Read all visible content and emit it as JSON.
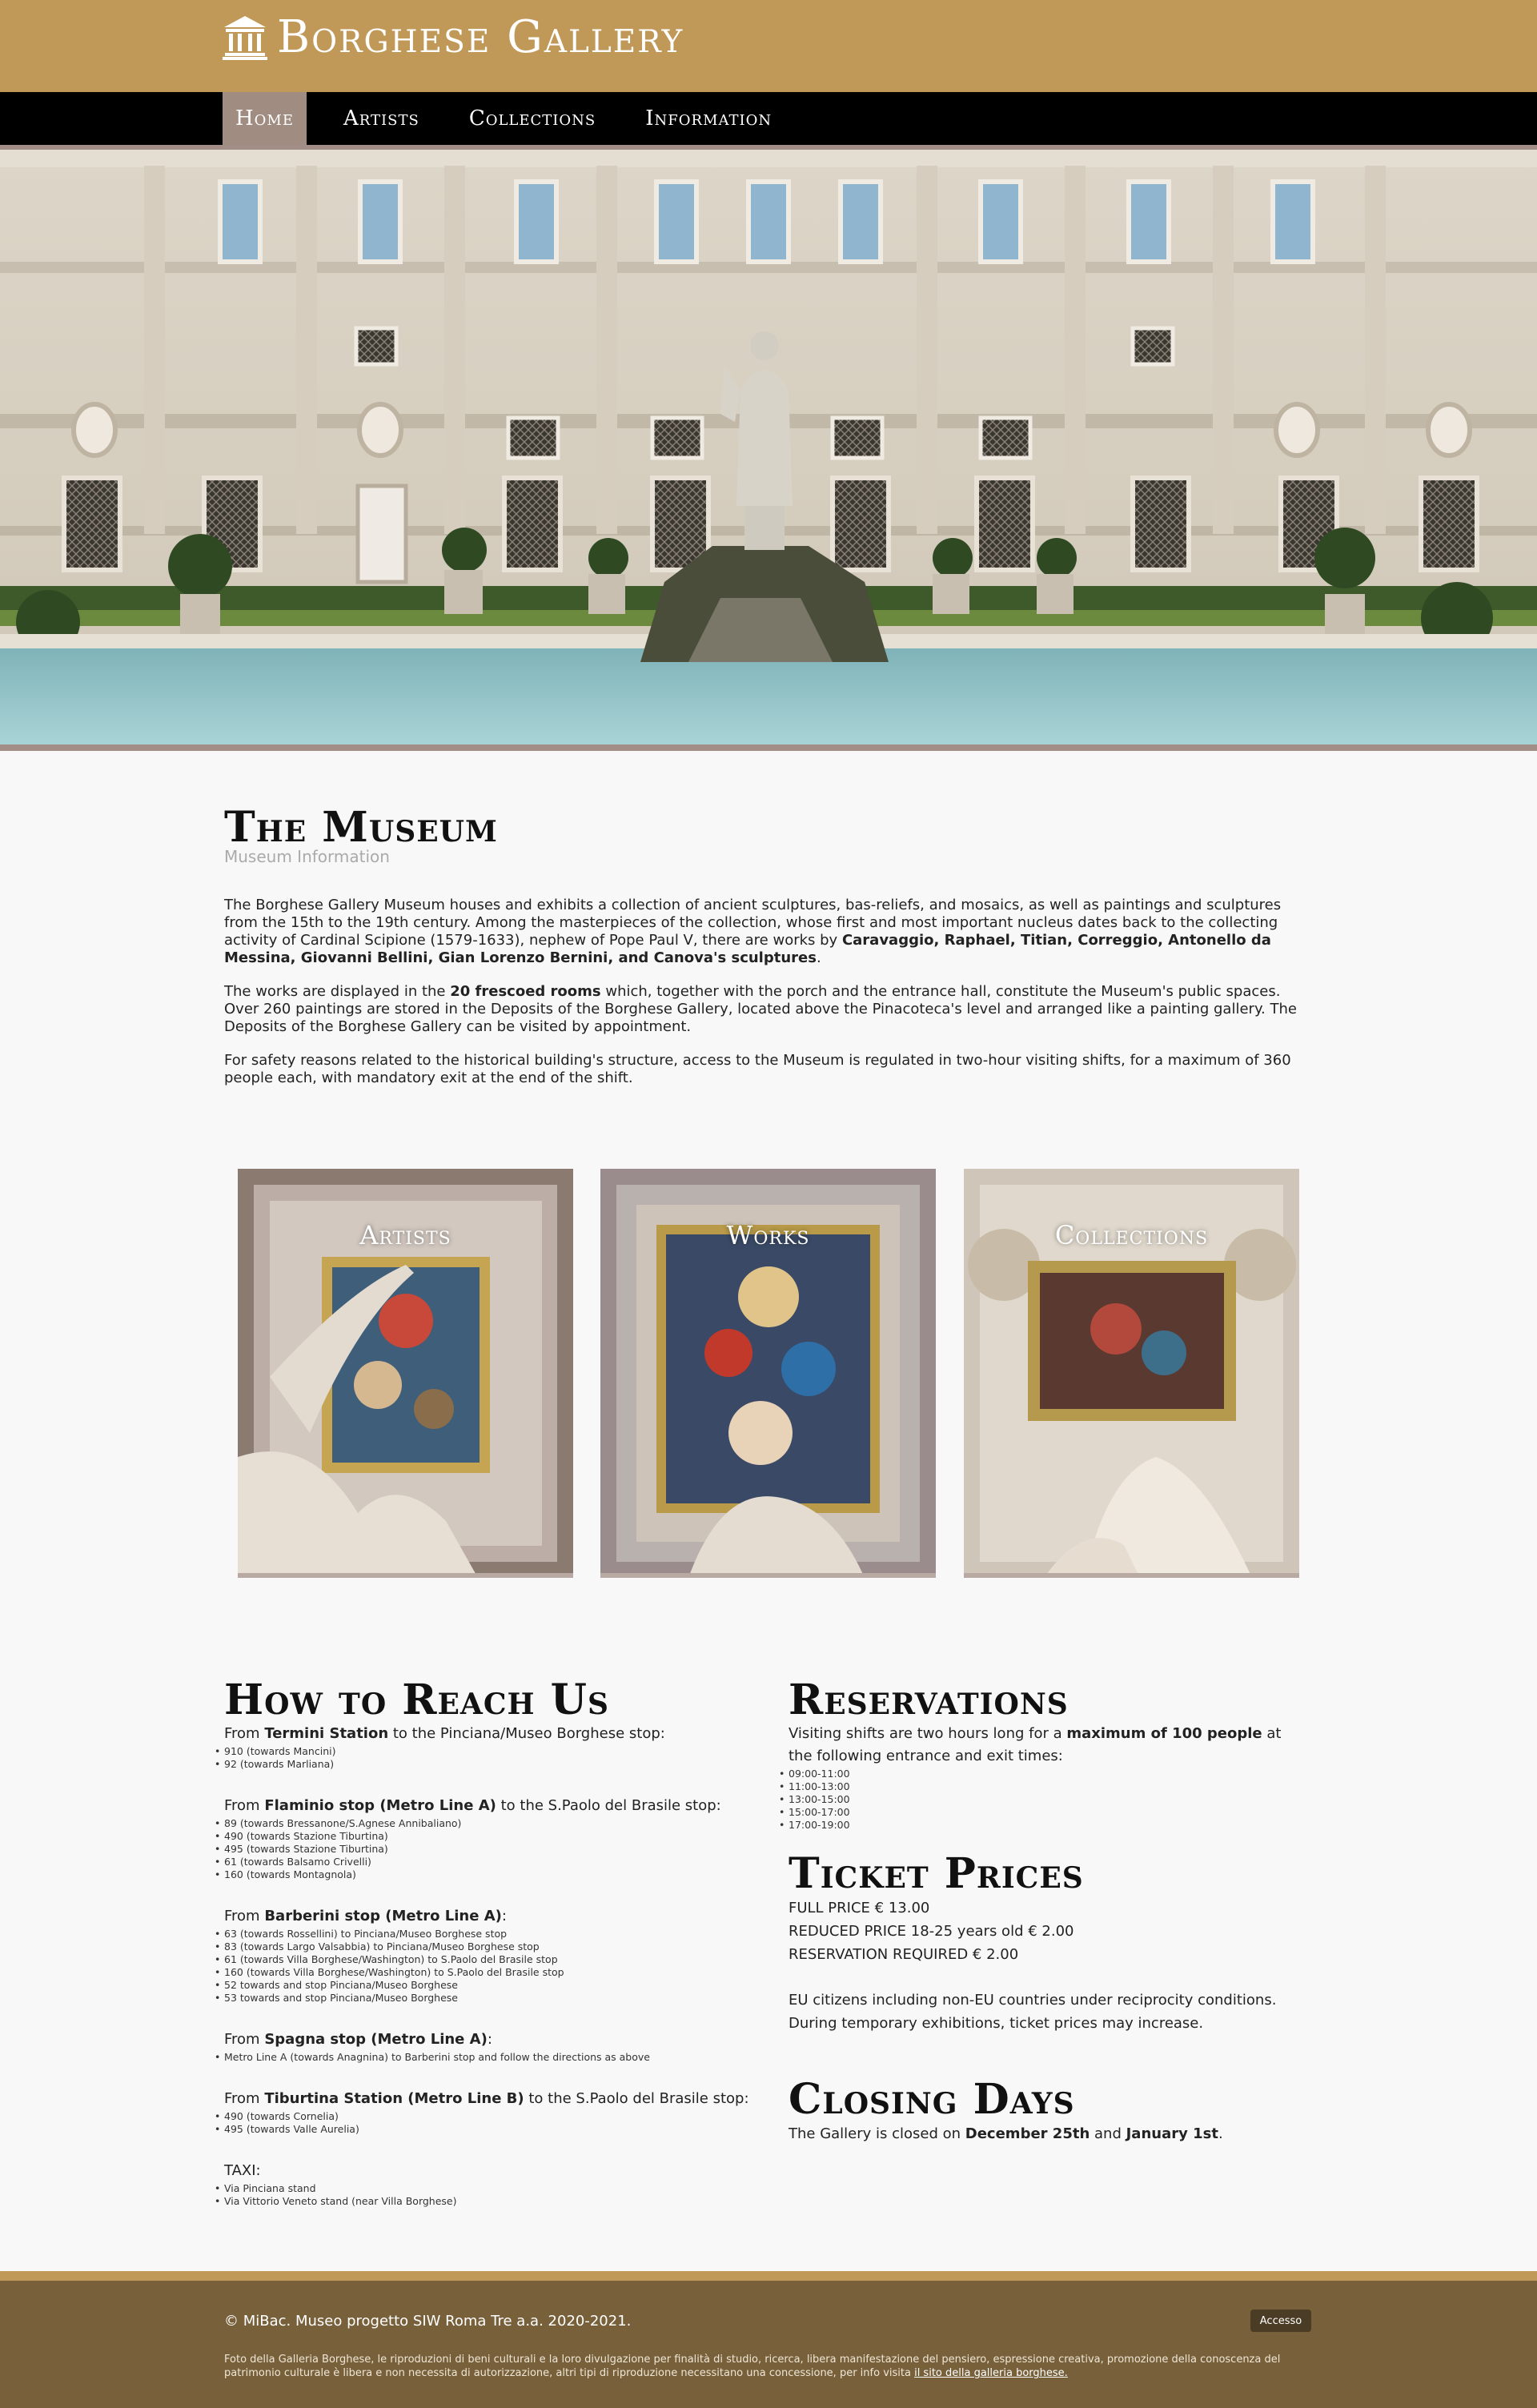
{
  "header": {
    "brand": "Borghese Gallery",
    "nav": [
      "Home",
      "Artists",
      "Collections",
      "Information"
    ],
    "active_nav": "Home"
  },
  "museum": {
    "title": "The Museum",
    "subtitle": "Museum Information",
    "p1_a": "The Borghese Gallery Museum houses and exhibits a collection of ancient sculptures, bas-reliefs, and mosaics, as well as paintings and sculptures from the 15th to the 19th century. Among the masterpieces of the collection, whose first and most important nucleus dates back to the collecting activity of Cardinal Scipione (1579-1633), nephew of Pope Paul V, there are works by ",
    "p1_b": "Caravaggio, Raphael, Titian, Correggio, Antonello da Messina, Giovanni Bellini, Gian Lorenzo Bernini, and Canova's sculptures",
    "p1_c": ".",
    "p2_a": "The works are displayed in the ",
    "p2_b": "20 frescoed rooms",
    "p2_c": " which, together with the porch and the entrance hall, constitute the Museum's public spaces. Over 260 paintings are stored in the Deposits of the Borghese Gallery, located above the Pinacoteca's level and arranged like a painting gallery. The Deposits of the Borghese Gallery can be visited by appointment.",
    "p3": "For safety reasons related to the historical building's structure, access to the Museum is regulated in two-hour visiting shifts, for a maximum of 360 people each, with mandatory exit at the end of the shift."
  },
  "cards": [
    "Artists",
    "Works",
    "Collections"
  ],
  "reach": {
    "title": "How to Reach Us",
    "groups": [
      {
        "pre": "From ",
        "bold": "Termini Station",
        "post": " to the Pinciana/Museo Borghese stop:",
        "items": [
          "910 (towards Mancini)",
          "92 (towards Marliana)"
        ]
      },
      {
        "pre": "From ",
        "bold": "Flaminio stop (Metro Line A)",
        "post": " to the S.Paolo del Brasile stop:",
        "items": [
          "89 (towards Bressanone/S.Agnese Annibaliano)",
          "490 (towards Stazione Tiburtina)",
          "495 (towards Stazione Tiburtina)",
          "61 (towards Balsamo Crivelli)",
          "160 (towards Montagnola)"
        ]
      },
      {
        "pre": "From ",
        "bold": "Barberini stop (Metro Line A)",
        "post": ":",
        "items": [
          "63 (towards Rossellini) to Pinciana/Museo Borghese stop",
          "83 (towards Largo Valsabbia) to Pinciana/Museo Borghese stop",
          "61 (towards Villa Borghese/Washington) to S.Paolo del Brasile stop",
          "160 (towards Villa Borghese/Washington) to S.Paolo del Brasile stop",
          "52 towards and stop Pinciana/Museo Borghese",
          "53 towards and stop Pinciana/Museo Borghese"
        ]
      },
      {
        "pre": "From ",
        "bold": "Spagna stop (Metro Line A)",
        "post": ":",
        "items": [
          "Metro Line A (towards Anagnina) to Barberini stop and follow the directions as above"
        ]
      },
      {
        "pre": "From ",
        "bold": "Tiburtina Station (Metro Line B)",
        "post": " to the S.Paolo del Brasile stop:",
        "items": [
          "490 (towards Cornelia)",
          "495 (towards Valle Aurelia)"
        ]
      },
      {
        "pre": "",
        "bold": "",
        "post": "TAXI:",
        "items": [
          "Via Pinciana stand",
          "Via Vittorio Veneto stand (near Villa Borghese)"
        ]
      }
    ]
  },
  "reservations": {
    "title": "Reservations",
    "text_a": "Visiting shifts are two hours long for a ",
    "text_b": "maximum of 100 people",
    "text_c": " at the following entrance and exit times:",
    "times": [
      "09:00-11:00",
      "11:00-13:00",
      "13:00-15:00",
      "15:00-17:00",
      "17:00-19:00"
    ]
  },
  "prices": {
    "title": "Ticket Prices",
    "lines": [
      "FULL PRICE € 13.00",
      "REDUCED PRICE 18-25 years old € 2.00",
      "RESERVATION REQUIRED € 2.00"
    ],
    "note1": "EU citizens including non-EU countries under reciprocity conditions.",
    "note2": "During temporary exhibitions, ticket prices may increase."
  },
  "closing": {
    "title": "Closing Days",
    "pre": "The Gallery is closed on ",
    "d1": "December 25th",
    "mid": " and ",
    "d2": "January 1st",
    "post": "."
  },
  "footer": {
    "copy_pre": "© ",
    "copy_link": "MiBac",
    "copy_post": ". Museo progetto SIW Roma Tre a.a. 2020-2021.",
    "login": "Accesso",
    "credit": "Foto della Galleria Borghese, le riproduzioni di beni culturali e la loro divulgazione per finalità di studio, ricerca, libera manifestazione del pensiero, espressione creativa, promozione della conoscenza del patrimonio culturale è libera e non necessita di autorizzazione, altri tipi di riproduzione necessitano una concessione, per info visita ",
    "credit_link": "il sito della galleria borghese."
  },
  "colors": {
    "header": "#c09858",
    "nav": "#000000",
    "nav_active": "#a08c80",
    "footer": "#77603a"
  },
  "icons": {
    "brand": "temple-icon"
  }
}
